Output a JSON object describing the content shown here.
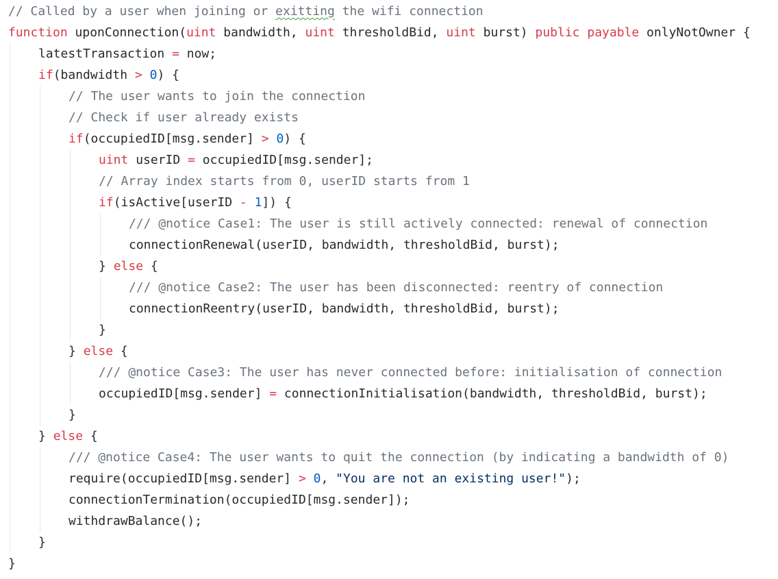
{
  "editor": {
    "lines": [
      {
        "indent": 0,
        "tokens": [
          {
            "t": "comment",
            "v": "// Called by a user when joining or "
          },
          {
            "t": "spell",
            "v": "exitting"
          },
          {
            "t": "comment",
            "v": " the wifi connection"
          }
        ]
      },
      {
        "indent": 0,
        "tokens": [
          {
            "t": "keyword",
            "v": "function"
          },
          {
            "t": "ident",
            "v": " uponConnection("
          },
          {
            "t": "keyword",
            "v": "uint"
          },
          {
            "t": "ident",
            "v": " bandwidth, "
          },
          {
            "t": "keyword",
            "v": "uint"
          },
          {
            "t": "ident",
            "v": " thresholdBid, "
          },
          {
            "t": "keyword",
            "v": "uint"
          },
          {
            "t": "ident",
            "v": " burst) "
          },
          {
            "t": "keyword",
            "v": "public"
          },
          {
            "t": "ident",
            "v": " "
          },
          {
            "t": "keyword",
            "v": "payable"
          },
          {
            "t": "ident",
            "v": " onlyNotOwner {"
          }
        ]
      },
      {
        "indent": 1,
        "tokens": [
          {
            "t": "ident",
            "v": "latestTransaction "
          },
          {
            "t": "op",
            "v": "="
          },
          {
            "t": "ident",
            "v": " now"
          },
          {
            "t": "punct",
            "v": ";"
          }
        ]
      },
      {
        "indent": 1,
        "tokens": [
          {
            "t": "keyword",
            "v": "if"
          },
          {
            "t": "ident",
            "v": "(bandwidth "
          },
          {
            "t": "op",
            "v": ">"
          },
          {
            "t": "ident",
            "v": " "
          },
          {
            "t": "number",
            "v": "0"
          },
          {
            "t": "ident",
            "v": ") {"
          }
        ]
      },
      {
        "indent": 2,
        "tokens": [
          {
            "t": "comment",
            "v": "// The user wants to join the connection"
          }
        ]
      },
      {
        "indent": 2,
        "tokens": [
          {
            "t": "comment",
            "v": "// Check if user already exists"
          }
        ]
      },
      {
        "indent": 2,
        "tokens": [
          {
            "t": "keyword",
            "v": "if"
          },
          {
            "t": "ident",
            "v": "(occupiedID[msg.sender] "
          },
          {
            "t": "op",
            "v": ">"
          },
          {
            "t": "ident",
            "v": " "
          },
          {
            "t": "number",
            "v": "0"
          },
          {
            "t": "ident",
            "v": ") {"
          }
        ]
      },
      {
        "indent": 3,
        "tokens": [
          {
            "t": "keyword",
            "v": "uint"
          },
          {
            "t": "ident",
            "v": " userID "
          },
          {
            "t": "op",
            "v": "="
          },
          {
            "t": "ident",
            "v": " occupiedID[msg.sender]"
          },
          {
            "t": "punct",
            "v": ";"
          }
        ]
      },
      {
        "indent": 3,
        "tokens": [
          {
            "t": "comment",
            "v": "// Array index starts from 0, userID starts from 1"
          }
        ]
      },
      {
        "indent": 3,
        "tokens": [
          {
            "t": "keyword",
            "v": "if"
          },
          {
            "t": "ident",
            "v": "(isActive[userID "
          },
          {
            "t": "op",
            "v": "-"
          },
          {
            "t": "ident",
            "v": " "
          },
          {
            "t": "number",
            "v": "1"
          },
          {
            "t": "ident",
            "v": "]) {"
          }
        ]
      },
      {
        "indent": 4,
        "tokens": [
          {
            "t": "comment",
            "v": "/// @notice Case1: The user is still actively connected: renewal of connection"
          }
        ]
      },
      {
        "indent": 4,
        "tokens": [
          {
            "t": "ident",
            "v": "connectionRenewal(userID, bandwidth, thresholdBid, burst)"
          },
          {
            "t": "punct",
            "v": ";"
          }
        ]
      },
      {
        "indent": 3,
        "tokens": [
          {
            "t": "ident",
            "v": "} "
          },
          {
            "t": "keyword",
            "v": "else"
          },
          {
            "t": "ident",
            "v": " {"
          }
        ]
      },
      {
        "indent": 4,
        "tokens": [
          {
            "t": "comment",
            "v": "/// @notice Case2: The user has been disconnected: reentry of connection"
          }
        ]
      },
      {
        "indent": 4,
        "tokens": [
          {
            "t": "ident",
            "v": "connectionReentry(userID, bandwidth, thresholdBid, burst)"
          },
          {
            "t": "punct",
            "v": ";"
          }
        ]
      },
      {
        "indent": 3,
        "tokens": [
          {
            "t": "ident",
            "v": "}"
          }
        ]
      },
      {
        "indent": 2,
        "tokens": [
          {
            "t": "ident",
            "v": "} "
          },
          {
            "t": "keyword",
            "v": "else"
          },
          {
            "t": "ident",
            "v": " {"
          }
        ]
      },
      {
        "indent": 3,
        "tokens": [
          {
            "t": "comment",
            "v": "/// @notice Case3: The user has never connected before: initialisation of connection"
          }
        ]
      },
      {
        "indent": 3,
        "tokens": [
          {
            "t": "ident",
            "v": "occupiedID[msg.sender] "
          },
          {
            "t": "op",
            "v": "="
          },
          {
            "t": "ident",
            "v": " connectionInitialisation(bandwidth, thresholdBid, burst)"
          },
          {
            "t": "punct",
            "v": ";"
          }
        ]
      },
      {
        "indent": 2,
        "tokens": [
          {
            "t": "ident",
            "v": "}"
          }
        ]
      },
      {
        "indent": 1,
        "tokens": [
          {
            "t": "ident",
            "v": "} "
          },
          {
            "t": "keyword",
            "v": "else"
          },
          {
            "t": "ident",
            "v": " {"
          }
        ]
      },
      {
        "indent": 2,
        "tokens": [
          {
            "t": "comment",
            "v": "/// @notice Case4: The user wants to quit the connection (by indicating a bandwidth of 0)"
          }
        ]
      },
      {
        "indent": 2,
        "tokens": [
          {
            "t": "ident",
            "v": "require(occupiedID[msg.sender] "
          },
          {
            "t": "op",
            "v": ">"
          },
          {
            "t": "ident",
            "v": " "
          },
          {
            "t": "number",
            "v": "0"
          },
          {
            "t": "ident",
            "v": ", "
          },
          {
            "t": "string",
            "v": "\"You are not an existing user!\""
          },
          {
            "t": "ident",
            "v": ")"
          },
          {
            "t": "punct",
            "v": ";"
          }
        ]
      },
      {
        "indent": 2,
        "tokens": [
          {
            "t": "ident",
            "v": "connectionTermination(occupiedID[msg.sender])"
          },
          {
            "t": "punct",
            "v": ";"
          }
        ]
      },
      {
        "indent": 2,
        "tokens": [
          {
            "t": "ident",
            "v": "withdrawBalance()"
          },
          {
            "t": "punct",
            "v": ";"
          }
        ]
      },
      {
        "indent": 1,
        "tokens": [
          {
            "t": "ident",
            "v": "}"
          }
        ]
      },
      {
        "indent": 0,
        "tokens": [
          {
            "t": "ident",
            "v": "}"
          }
        ]
      }
    ]
  }
}
